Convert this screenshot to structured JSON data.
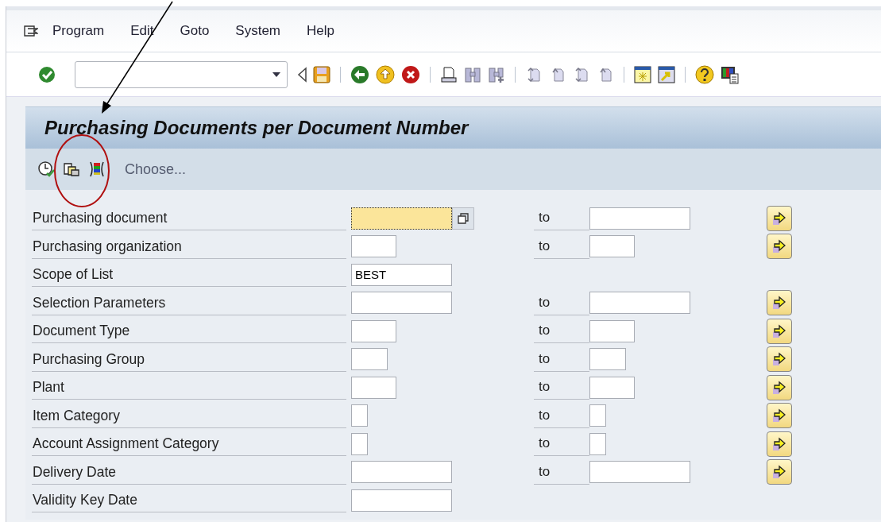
{
  "menu": [
    "Program",
    "Edit",
    "Goto",
    "System",
    "Help"
  ],
  "title": "Purchasing Documents per Document Number",
  "app_toolbar": {
    "choose": "Choose..."
  },
  "rows": [
    {
      "label": "Purchasing document",
      "kind": "long",
      "value": "",
      "focused": true,
      "range": true,
      "to": "to"
    },
    {
      "label": "Purchasing organization",
      "kind": "medium",
      "value": "",
      "focused": false,
      "range": true,
      "to": "to"
    },
    {
      "label": "Scope of List",
      "kind": "long",
      "value": "BEST",
      "focused": false,
      "range": false
    },
    {
      "label": "Selection Parameters",
      "kind": "long",
      "value": "",
      "focused": false,
      "range": true,
      "to": "to"
    },
    {
      "label": "Document Type",
      "kind": "medium",
      "value": "",
      "focused": false,
      "range": true,
      "to": "to"
    },
    {
      "label": "Purchasing Group",
      "kind": "short",
      "value": "",
      "focused": false,
      "range": true,
      "to": "to"
    },
    {
      "label": "Plant",
      "kind": "medium",
      "value": "",
      "focused": false,
      "range": true,
      "to": "to"
    },
    {
      "label": "Item Category",
      "kind": "tiny",
      "value": "",
      "focused": false,
      "range": true,
      "to": "to"
    },
    {
      "label": "Account Assignment Category",
      "kind": "tiny",
      "value": "",
      "focused": false,
      "range": true,
      "to": "to"
    },
    {
      "label": "Delivery Date",
      "kind": "long",
      "value": "",
      "focused": false,
      "range": true,
      "to": "to"
    },
    {
      "label": "Validity Key Date",
      "kind": "long",
      "value": "",
      "focused": false,
      "range": false
    }
  ]
}
